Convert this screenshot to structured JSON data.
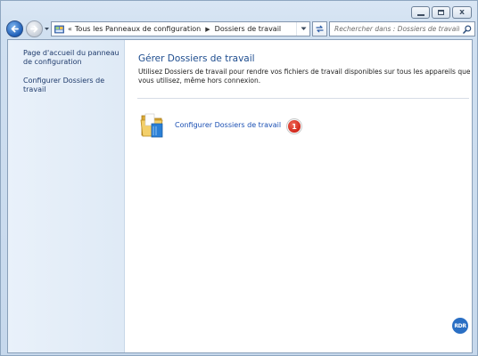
{
  "window": {
    "caption_buttons": {
      "minimize": "minimize",
      "maximize": "maximize",
      "close": "x"
    }
  },
  "nav": {
    "back_icon": "back-arrow",
    "forward_icon": "forward-arrow",
    "address": {
      "overflow_chevron": "«",
      "crumbs": [
        "Tous les Panneaux de configuration",
        "Dossiers de travail"
      ],
      "separator": "▶"
    },
    "search": {
      "placeholder": "Rechercher dans : Dossiers de travail"
    }
  },
  "sidebar": {
    "items": [
      {
        "label": "Page d'accueil du panneau de configuration"
      },
      {
        "label": "Configurer Dossiers de travail"
      }
    ]
  },
  "main": {
    "title": "Gérer Dossiers de travail",
    "description": "Utilisez Dossiers de travail pour rendre vos fichiers de travail disponibles sur tous les appareils que vous utilisez, même hors connexion.",
    "task": {
      "label": "Configurer Dossiers de travail",
      "icon": "work-folders-icon",
      "badge": "1"
    }
  },
  "watermark": {
    "text": "RDR"
  },
  "colors": {
    "title": "#1e4d8f",
    "link": "#1a4fb3",
    "badge": "#d1261a",
    "sidebar_bg": "#e5eef8"
  }
}
